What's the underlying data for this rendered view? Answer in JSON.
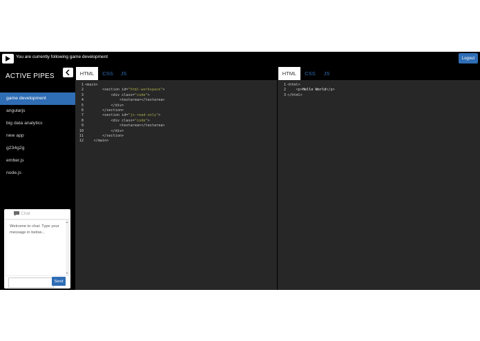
{
  "topbar": {
    "following_text": "You are currently following game development",
    "logout_label": "Logout"
  },
  "sidebar": {
    "title": "ACTIVE PIPES",
    "items": [
      "game development",
      "angularjs",
      "big data analytics",
      "new app",
      "g234g2g",
      "ember.js",
      "node.js"
    ],
    "active_index": 0
  },
  "chat": {
    "title": "Chat",
    "welcome": "Welcome to chat. Type your message in below...",
    "input_value": "",
    "send_label": "Send"
  },
  "left_pane": {
    "tabs": [
      "HTML",
      "CSS",
      "JS"
    ],
    "active_tab": "HTML",
    "line_numbers": [
      "1",
      "2",
      "3",
      "4",
      "5",
      "6",
      "7",
      "8",
      "9",
      "10",
      "11",
      "12"
    ],
    "lines": [
      "<main>",
      "        <section id=\"html-workspace\">",
      "            <div class=\"code\">",
      "                <textarea></textarea>",
      "            </div>",
      "        </section>",
      "        <section id=\"js-read-only\">",
      "            <div class=\"code\">",
      "                <textarea></textarea>",
      "            </div>",
      "        </section>",
      "    </main>"
    ]
  },
  "right_pane": {
    "tabs": [
      "HTML",
      "CSS",
      "JS"
    ],
    "active_tab": "HTML",
    "line_numbers": [
      "1",
      "2",
      "3"
    ],
    "lines": [
      "<html>",
      "    <p>Hello World</p>",
      "</html>"
    ]
  },
  "colors": {
    "accent": "#2f6db5",
    "editor_bg": "#272727",
    "app_bg": "#000000"
  },
  "icons": {
    "play": "play-icon",
    "collapse": "chevron-left-icon",
    "chat": "chat-bubble-icon"
  }
}
